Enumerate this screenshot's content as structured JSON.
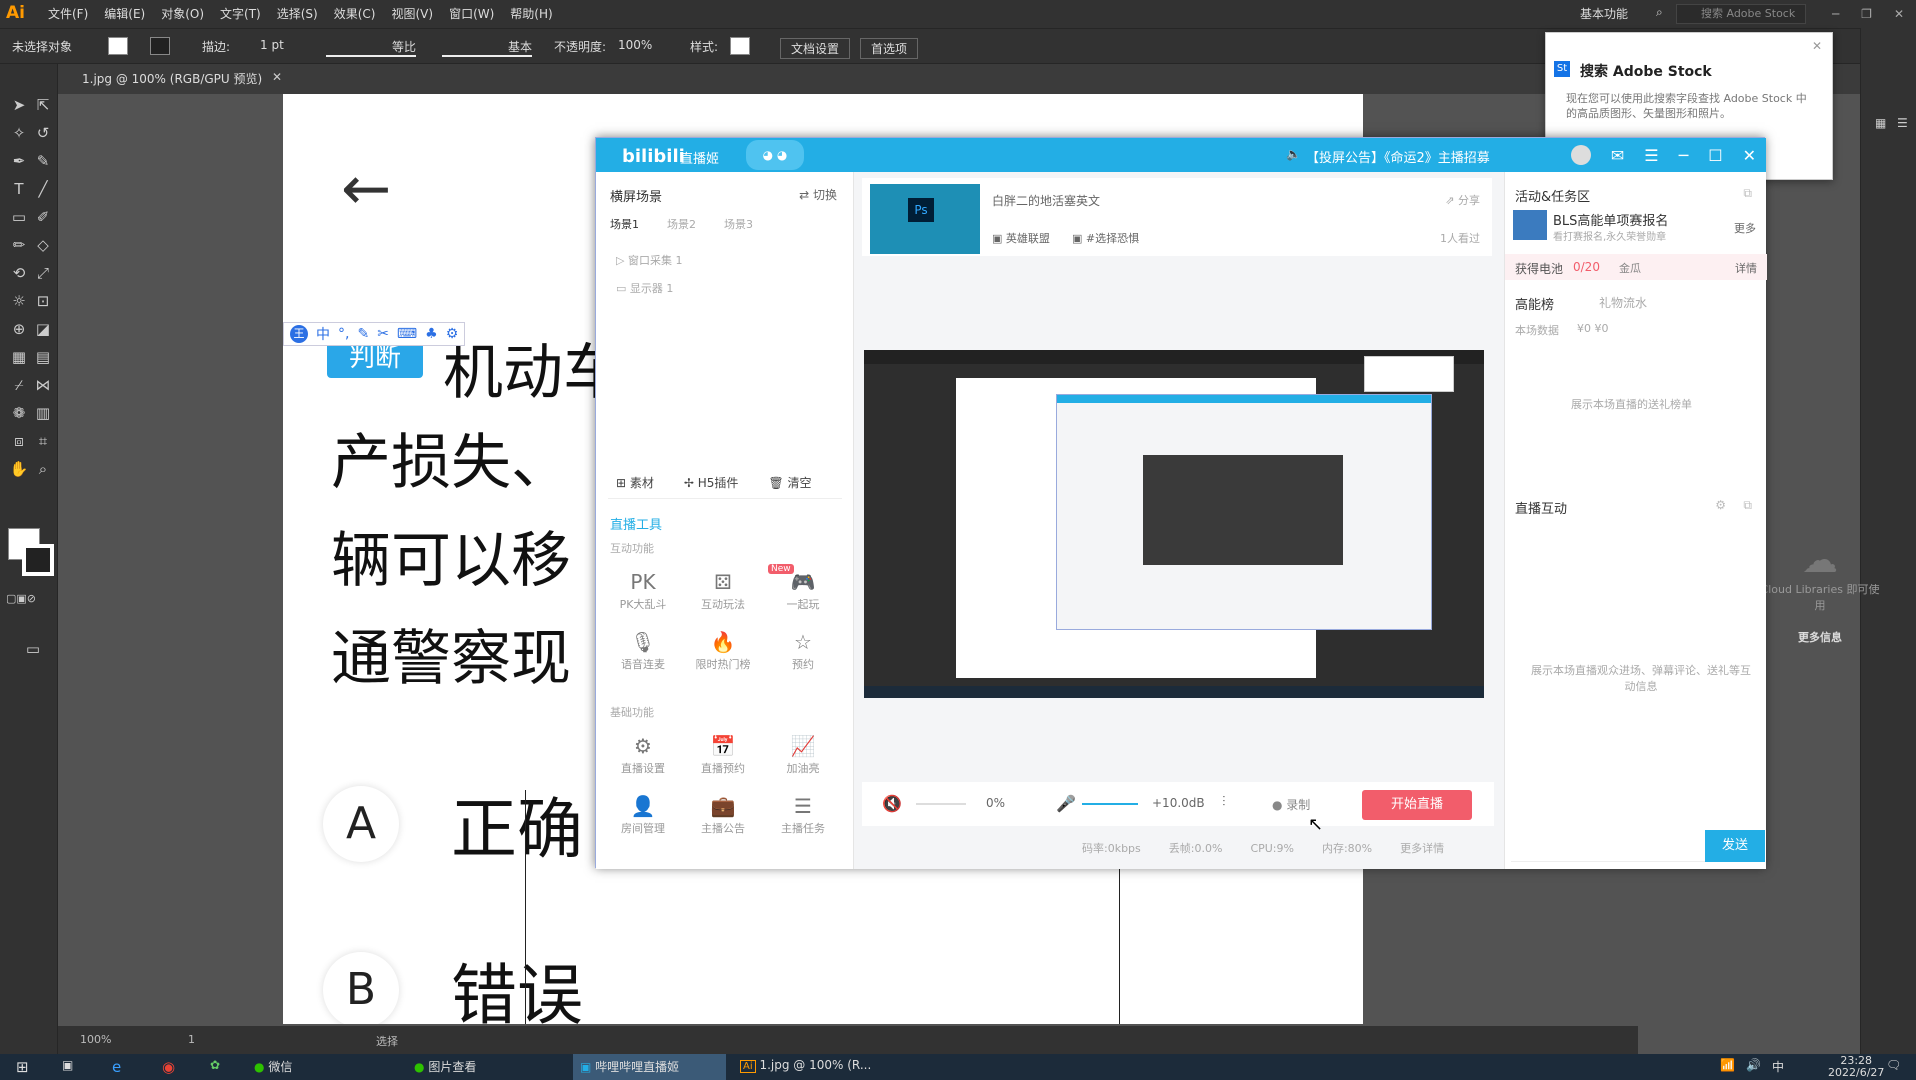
{
  "ai": {
    "logo": "Ai",
    "menus": [
      "文件(F)",
      "编辑(E)",
      "对象(O)",
      "文字(T)",
      "选择(S)",
      "效果(C)",
      "视图(V)",
      "窗口(W)",
      "帮助(H)"
    ],
    "workspace": "基本功能",
    "stock_search_placeholder": "搜索 Adobe Stock",
    "control": {
      "no_selection": "未选择对象",
      "stroke_label": "描边:",
      "stroke_value": "1 pt",
      "stroke_style1": "等比",
      "stroke_style2": "基本",
      "opacity_label": "不透明度:",
      "opacity_value": "100%",
      "style_label": "样式:",
      "doc_setup": "文档设置",
      "preferences": "首选项"
    },
    "doc_tab": "1.jpg @ 100% (RGB/GPU 预览)",
    "status": {
      "zoom": "100%",
      "page": "1",
      "mode": "选择"
    },
    "cloud_lib": "Cloud Libraries 即可使用",
    "cloud_more": "更多信息"
  },
  "stock_popup": {
    "title": "搜索 Adobe Stock",
    "desc": "现在您可以使用此搜索字段查找 Adobe Stock 中的高品质图形、矢量图形和照片。"
  },
  "artboard": {
    "tag": "判断",
    "lines": [
      "机动车",
      "产损失、",
      "辆可以移",
      "通警察现"
    ],
    "options": [
      {
        "letter": "A",
        "text": "正确"
      },
      {
        "letter": "B",
        "text": "错误"
      }
    ]
  },
  "ime_toolbar": "中",
  "bili": {
    "logo": "bilibili",
    "logo_sub": "直播姬",
    "announce": "【投屏公告】《命运2》主播招募",
    "left": {
      "scene_title": "横屏场景",
      "switch": "切换",
      "scene_tabs": [
        "场景1",
        "场景2",
        "场景3"
      ],
      "sources": [
        "窗口采集 1",
        "显示器 1"
      ],
      "actions": [
        "素材",
        "H5插件",
        "清空"
      ],
      "tools_title": "直播工具",
      "interactive_title": "互动功能",
      "interactive": [
        "PK大乱斗",
        "互动玩法",
        "一起玩",
        "语音连麦",
        "限时热门榜",
        "预约"
      ],
      "new_badge": "New",
      "basic_title": "基础功能",
      "basic": [
        "直播设置",
        "直播预约",
        "加油亮",
        "房间管理",
        "主播公告",
        "主播任务"
      ]
    },
    "center": {
      "room_title": "白胖二的地活塞英文",
      "share": "分享",
      "tag1": "英雄联盟",
      "tag2": "#选择恐惧",
      "viewers": "1人看过",
      "vol_pct": "0%",
      "mic_db": "+10.0dB",
      "record": "录制",
      "start": "开始直播",
      "stats": [
        "码率:0kbps",
        "丢帧:0.0%",
        "CPU:9%",
        "内存:80%",
        "更多详情"
      ]
    },
    "right": {
      "activity_title": "活动&任务区",
      "activity_item": "BLS高能单项赛报名",
      "activity_sub": "看打赛报名,永久荣誉勋章",
      "more": "更多",
      "battery": "获得电池",
      "battery_val": "0/20",
      "battery_tag": "金瓜",
      "detail": "详情",
      "high_energy": "高能榜",
      "gift_flow": "礼物流水",
      "session": "本场数据",
      "session_vals": "¥0  ¥0",
      "hint1": "展示本场直播的送礼榜单",
      "interact_title": "直播互动",
      "hint2": "展示本场直播观众进场、弹幕评论、送礼等互动信息",
      "send": "发送"
    }
  },
  "taskbar": {
    "wechat": "微信",
    "photos": "图片查看",
    "bili": "哔哩哔哩直播姬",
    "ai": "1.jpg @ 100% (R...",
    "ime": "中",
    "time": "23:28",
    "date": "2022/6/27"
  }
}
